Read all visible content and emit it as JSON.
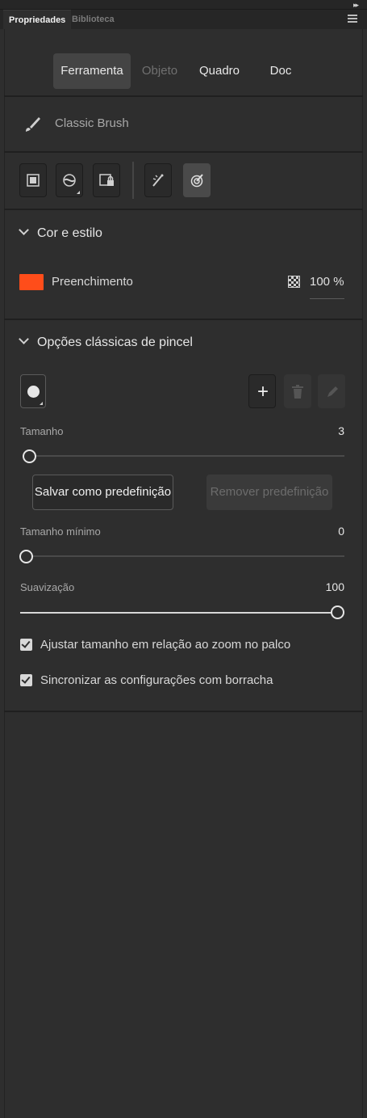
{
  "panel_tabs": [
    {
      "label": "Propriedades",
      "active": true
    },
    {
      "label": "Biblioteca",
      "active": false
    }
  ],
  "context_tabs": [
    {
      "label": "Ferramenta",
      "state": "selected"
    },
    {
      "label": "Objeto",
      "state": "disabled"
    },
    {
      "label": "Quadro",
      "state": "normal"
    },
    {
      "label": "Doc",
      "state": "normal"
    }
  ],
  "tool": {
    "name": "Classic Brush",
    "icon": "brush-icon"
  },
  "tool_buttons": [
    {
      "name": "object-drawing-mode-icon",
      "active": false
    },
    {
      "name": "brush-mode-icon",
      "active": false
    },
    {
      "name": "lock-fill-icon",
      "active": false
    },
    {
      "name": "pressure-icon",
      "active": false
    },
    {
      "name": "tilt-icon",
      "active": true
    }
  ],
  "color_style": {
    "header": "Cor e estilo",
    "fill_label": "Preenchimento",
    "fill_color": "#ff4d1a",
    "alpha": "100 %"
  },
  "brush_options": {
    "header": "Opções clássicas de pincel",
    "size_label": "Tamanho",
    "size_value": "3",
    "size_fraction": 0.0,
    "save_preset": "Salvar como predefinição",
    "remove_preset": "Remover predefinição",
    "min_size_label": "Tamanho mínimo",
    "min_size_value": "0",
    "min_size_fraction": 0.0,
    "smoothing_label": "Suavização",
    "smoothing_value": "100",
    "smoothing_fraction": 1.0,
    "check_zoom": "Ajustar tamanho em relação ao zoom no palco",
    "check_sync": "Sincronizar as configurações com borracha"
  }
}
